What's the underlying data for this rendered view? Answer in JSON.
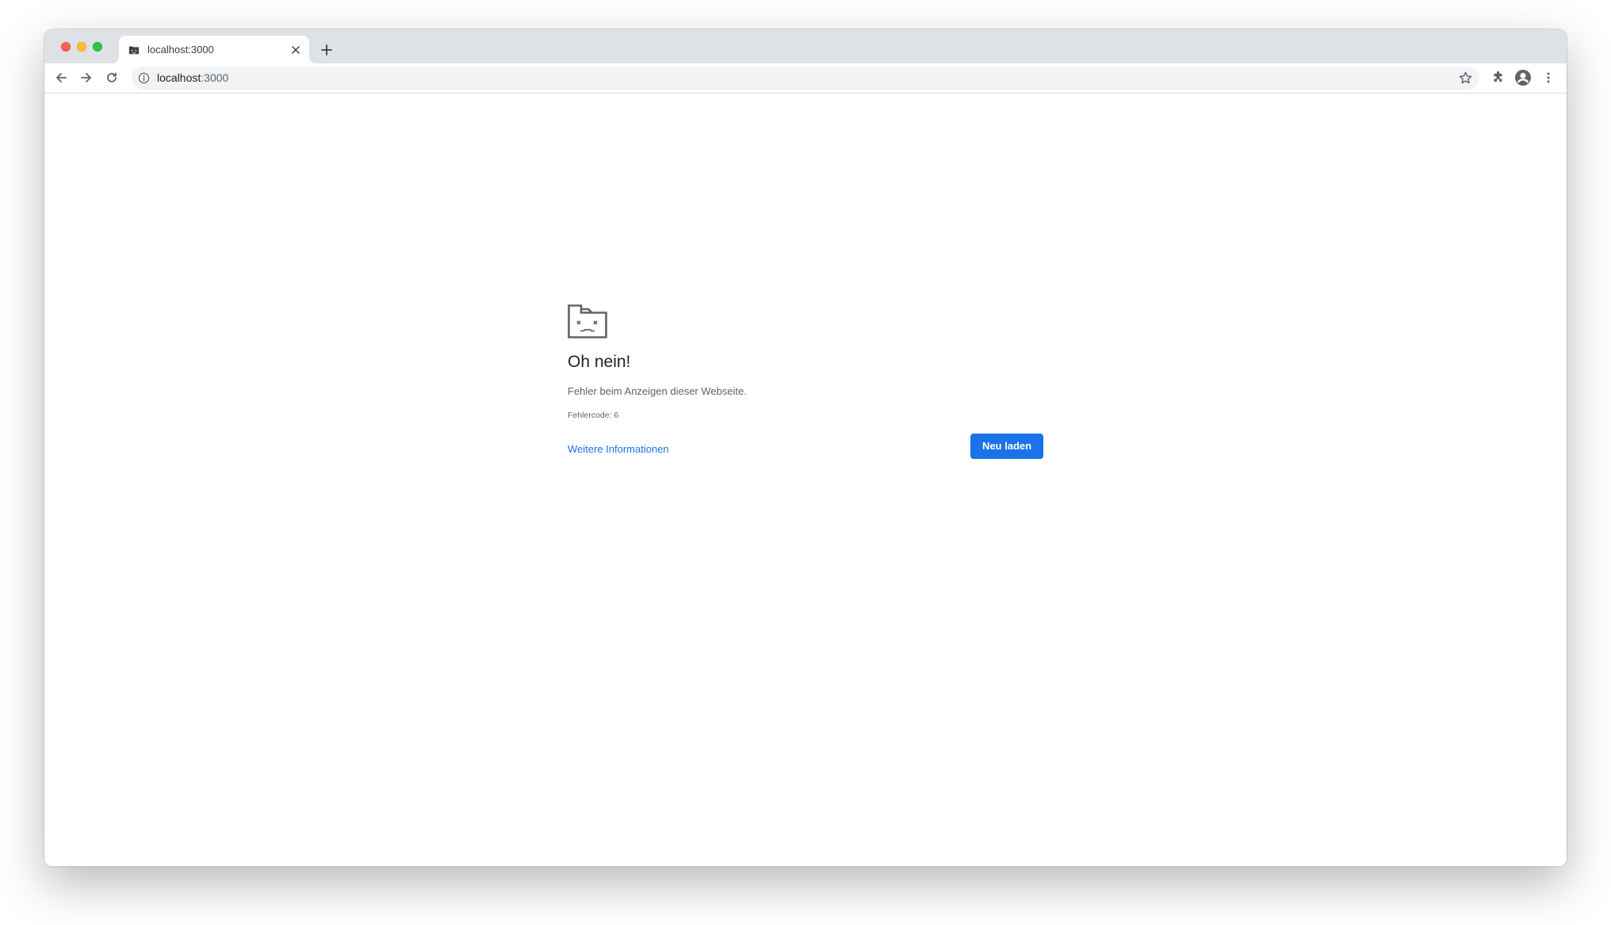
{
  "window": {
    "controls": [
      "close",
      "minimize",
      "maximize"
    ]
  },
  "tab": {
    "title": "localhost:3000",
    "favicon": "sad-tab-icon",
    "close_icon": "close-icon"
  },
  "toolbar": {
    "back_icon": "arrow-left-icon",
    "forward_icon": "arrow-right-icon",
    "reload_icon": "reload-icon",
    "url_host": "localhost",
    "url_port": ":3000",
    "info_icon": "info-icon",
    "bookmark_icon": "star-icon",
    "extensions_icon": "puzzle-icon",
    "profile_icon": "account-icon",
    "menu_icon": "kebab-menu-icon"
  },
  "error_page": {
    "icon": "sad-folder-icon",
    "title": "Oh nein!",
    "message": "Fehler beim Anzeigen dieser Webseite.",
    "code": "Fehlercode: 6",
    "link": "Weitere Informationen",
    "button": "Neu laden"
  },
  "colors": {
    "tabstrip": "#dee1e6",
    "omnibox": "#f1f3f4",
    "accent": "#1a73e8",
    "text_primary": "#202124",
    "text_secondary": "#5f6368"
  }
}
